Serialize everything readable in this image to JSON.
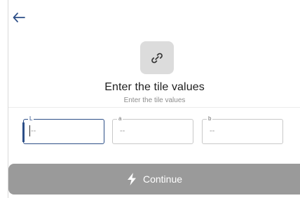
{
  "header": {
    "back_icon": "arrow-left-icon"
  },
  "hero": {
    "icon": "link-icon",
    "title": "Enter the tile values",
    "subtitle": "Enter the tile values"
  },
  "fields": [
    {
      "label": "L",
      "value": "--"
    },
    {
      "label": "a",
      "value": "--"
    },
    {
      "label": "b",
      "value": "--"
    }
  ],
  "actions": {
    "continue_label": "Continue",
    "continue_icon": "lightning-bolt-icon"
  },
  "colors": {
    "accent": "#2c4e87",
    "button_disabled": "#9a9a9a",
    "icon_tile": "#dcdcdc"
  }
}
